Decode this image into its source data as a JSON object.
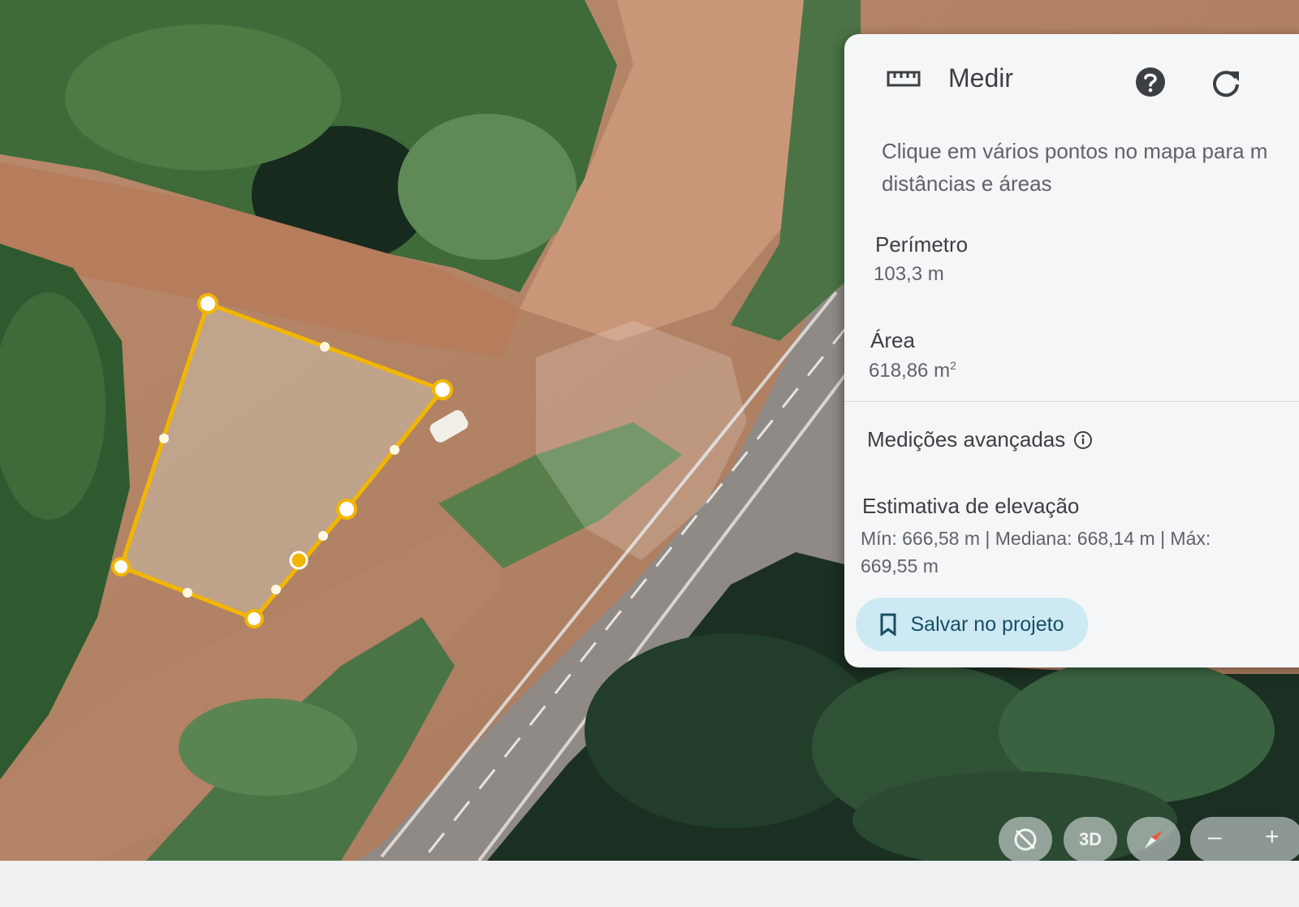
{
  "panel": {
    "title": "Medir",
    "hint": "Clique em vários pontos no mapa para m",
    "hint_line2": "distâncias e áreas",
    "perimeter_label": "Perímetro",
    "perimeter_value": "103,3 m",
    "area_label": "Área",
    "area_value": "618,86 m",
    "area_unit_exp": "2",
    "advanced_label": "Medições avançadas",
    "elevation_title": "Estimativa de elevação",
    "elevation_line1": "Mín: 666,58 m | Mediana: 668,14 m | Máx:",
    "elevation_line2": "669,55 m",
    "save_label": "Salvar no projeto",
    "icons": [
      "ruler-icon",
      "help-icon",
      "refresh-icon",
      "info-icon",
      "bookmark-icon"
    ]
  },
  "map_controls": {
    "three_d_label": "3D",
    "zoom_out_label": "–",
    "zoom_in_label": "+",
    "icons": [
      "hide-layer-icon",
      "compass-icon"
    ]
  },
  "measurement": {
    "shape": "polygon",
    "vertices": 5,
    "outline_color": "#f2b600"
  },
  "colors": {
    "accent_button": "#cde9f3",
    "panel_bg": "#f5f6f7"
  }
}
